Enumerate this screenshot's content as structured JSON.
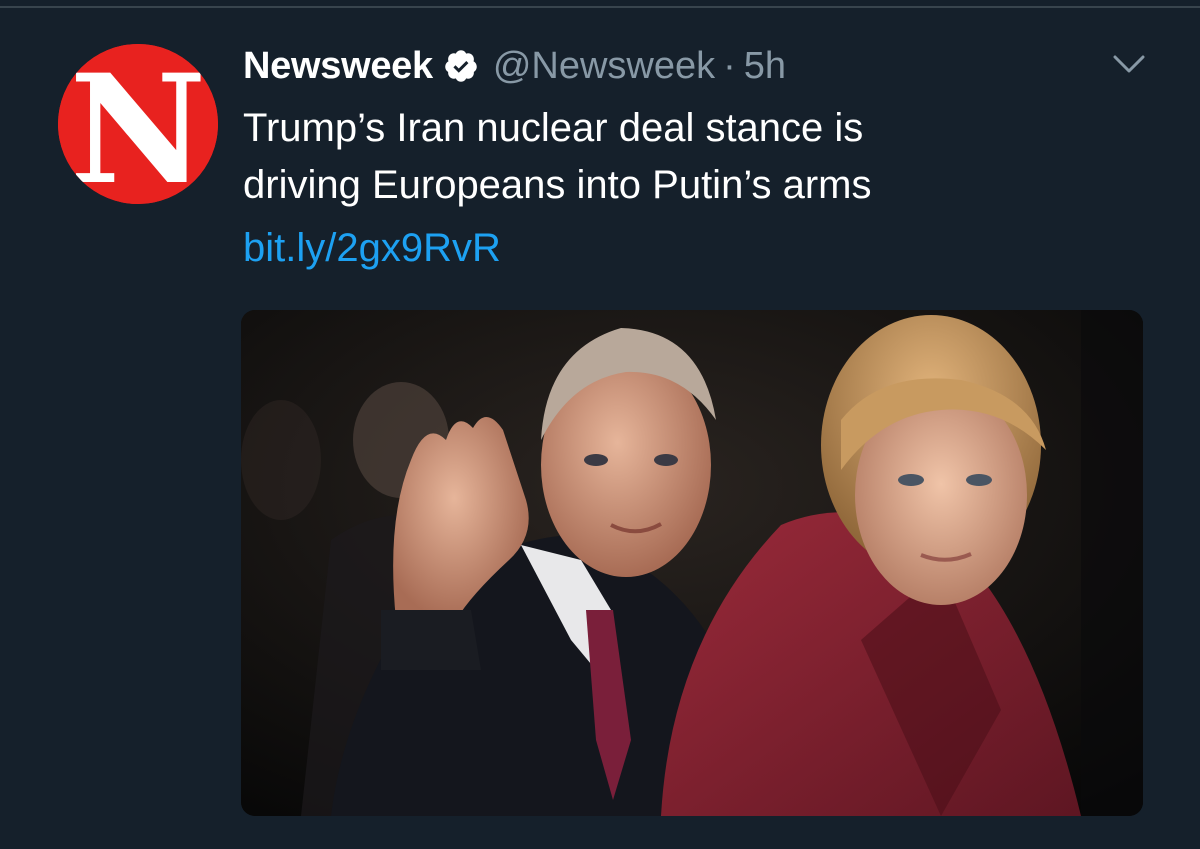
{
  "tweet": {
    "author": {
      "display_name": "Newsweek",
      "handle": "@Newsweek",
      "avatar_letter": "N",
      "verified": true
    },
    "separator": "·",
    "timestamp": "5h",
    "text_lines": [
      "Trump’s Iran nuclear deal stance is",
      "driving Europeans into Putin’s arms"
    ],
    "link": "bit.ly/2gx9RvR",
    "media": {
      "alt": "photo"
    }
  },
  "icons": {
    "verified": "verified-badge-icon",
    "menu": "chevron-down-icon"
  },
  "colors": {
    "background": "#15202b",
    "text": "#ffffff",
    "muted": "#8899a6",
    "link": "#1da1f2",
    "avatar_brand": "#e8221f"
  }
}
